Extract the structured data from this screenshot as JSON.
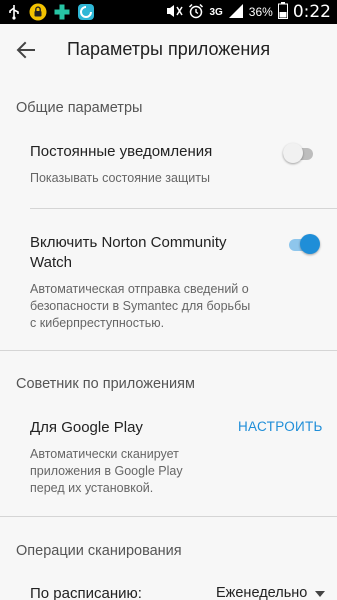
{
  "status_bar": {
    "network": "3G",
    "battery_percent": "36%",
    "time": "0:22",
    "icons": [
      "usb-icon",
      "lock-icon",
      "plus-app-icon",
      "shield-app-icon",
      "mute-icon",
      "alarm-icon",
      "signal-icon",
      "battery-icon"
    ]
  },
  "app_bar": {
    "title": "Параметры приложения",
    "back_icon": "arrow-back-icon"
  },
  "sections": {
    "general": {
      "header": "Общие параметры",
      "persistent_notifications": {
        "title": "Постоянные уведомления",
        "subtitle": "Показывать состояние защиты",
        "enabled": false
      },
      "community_watch": {
        "title_line1": "Включить Norton Community",
        "title_line2": "Watch",
        "desc_line1": "Автоматическая отправка сведений о",
        "desc_line2": "безопасности в Symantec для борьбы",
        "desc_line3": "с киберпреступностью.",
        "enabled": true
      }
    },
    "app_advisor": {
      "header": "Советник по приложениям",
      "google_play": {
        "title": "Для Google Play",
        "action": "НАСТРОИТЬ",
        "desc_line1": "Автоматически сканирует",
        "desc_line2": "приложения в Google Play",
        "desc_line3": "перед их установкой."
      }
    },
    "scan": {
      "header": "Операции сканирования",
      "schedule": {
        "title": "По расписанию:",
        "value": "Еженедельно"
      }
    }
  },
  "colors": {
    "accent": "#1f8ed8",
    "accent_track": "#8ec6ec",
    "off_thumb": "#f1f1f1",
    "off_track": "#bdbdbd"
  }
}
